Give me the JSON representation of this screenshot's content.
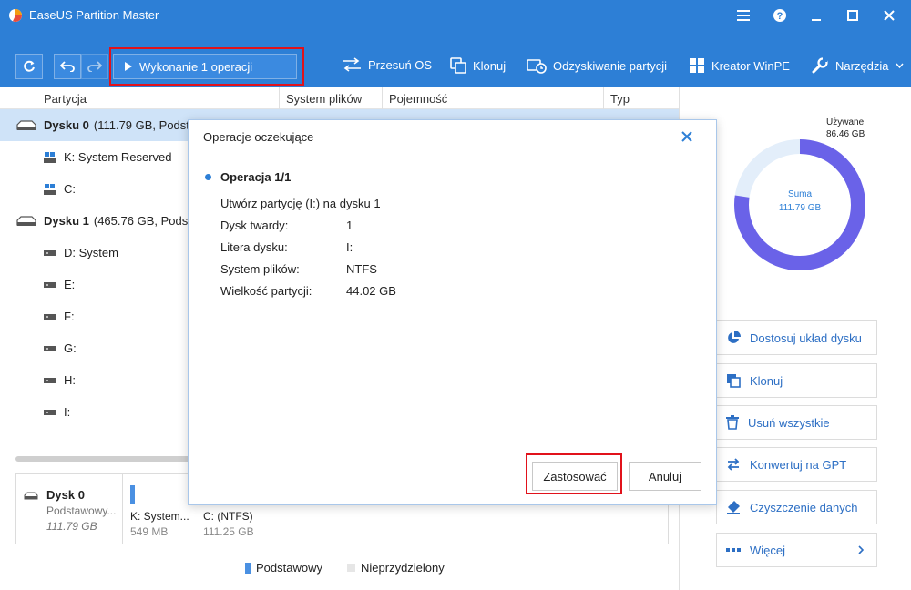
{
  "app": {
    "title": "EaseUS Partition Master",
    "colors": {
      "accent": "#2d7fd6",
      "highlight_box": "#e1121b",
      "selected_row": "#cfe3f8",
      "link": "#2d6fc4"
    }
  },
  "titlebar": {
    "icons": [
      "menu-icon",
      "help-icon",
      "minimize-icon",
      "maximize-icon",
      "close-icon"
    ]
  },
  "toolbar": {
    "execute_label": "Wykonanie 1 operacji",
    "items": [
      {
        "label": "Przesuń OS",
        "icon": "migrate-os-icon"
      },
      {
        "label": "Klonuj",
        "icon": "clone-icon"
      },
      {
        "label": "Odzyskiwanie partycji",
        "icon": "recovery-icon"
      },
      {
        "label": "Kreator WinPE",
        "icon": "windows-icon"
      },
      {
        "label": "Narzędzia",
        "icon": "wrench-icon"
      }
    ]
  },
  "table": {
    "columns": [
      "Partycja",
      "System plików",
      "Pojemność",
      "Typ"
    ],
    "rows": [
      {
        "label": "Dysku 0",
        "detail": "(111.79 GB, Podst",
        "kind": "disk"
      },
      {
        "label": "K: System Reserved",
        "kind": "system-partition"
      },
      {
        "label": "C:",
        "kind": "system-partition"
      },
      {
        "label": "Dysku 1",
        "detail": "(465.76 GB, Podst",
        "kind": "disk"
      },
      {
        "label": "D: System",
        "kind": "partition"
      },
      {
        "label": "E:",
        "kind": "partition"
      },
      {
        "label": "F:",
        "kind": "partition"
      },
      {
        "label": "G:",
        "kind": "partition"
      },
      {
        "label": "H:",
        "kind": "partition"
      },
      {
        "label": "I:",
        "kind": "partition"
      }
    ]
  },
  "diskmap": {
    "name": "Dysk 0",
    "type": "Podstawowy...",
    "size": "111.79 GB",
    "partitions": [
      {
        "label": "K: System...",
        "size": "549 MB"
      },
      {
        "label": "C: (NTFS)",
        "size": "111.25 GB"
      }
    ]
  },
  "legend": [
    "Podstawowy",
    "Nieprzydzielony"
  ],
  "usage": {
    "used_label": "Używane",
    "used_value": "86.46 GB",
    "total_label": "Suma",
    "total_value": "111.79 GB",
    "used_fraction": 0.773
  },
  "sidebar": {
    "buttons": [
      {
        "label": "Dostosuj układ dysku",
        "icon": "pie-chart-icon"
      },
      {
        "label": "Klonuj",
        "icon": "clone-icon"
      },
      {
        "label": "Usuń wszystkie",
        "icon": "trash-icon"
      },
      {
        "label": "Konwertuj na GPT",
        "icon": "convert-icon"
      },
      {
        "label": "Czyszczenie danych",
        "icon": "eraser-icon"
      },
      {
        "label": "Więcej",
        "icon": "more-icon"
      }
    ]
  },
  "dialog": {
    "title": "Operacje oczekujące",
    "operation_header": "Operacja 1/1",
    "description": "Utwórz partycję (I:) na dysku 1",
    "fields": [
      {
        "key": "Dysk twardy:",
        "value": "1"
      },
      {
        "key": "Litera dysku:",
        "value": "I:"
      },
      {
        "key": "System plików:",
        "value": "NTFS"
      },
      {
        "key": "Wielkość partycji:",
        "value": "44.02 GB"
      }
    ],
    "apply_label": "Zastosować",
    "cancel_label": "Anuluj"
  }
}
